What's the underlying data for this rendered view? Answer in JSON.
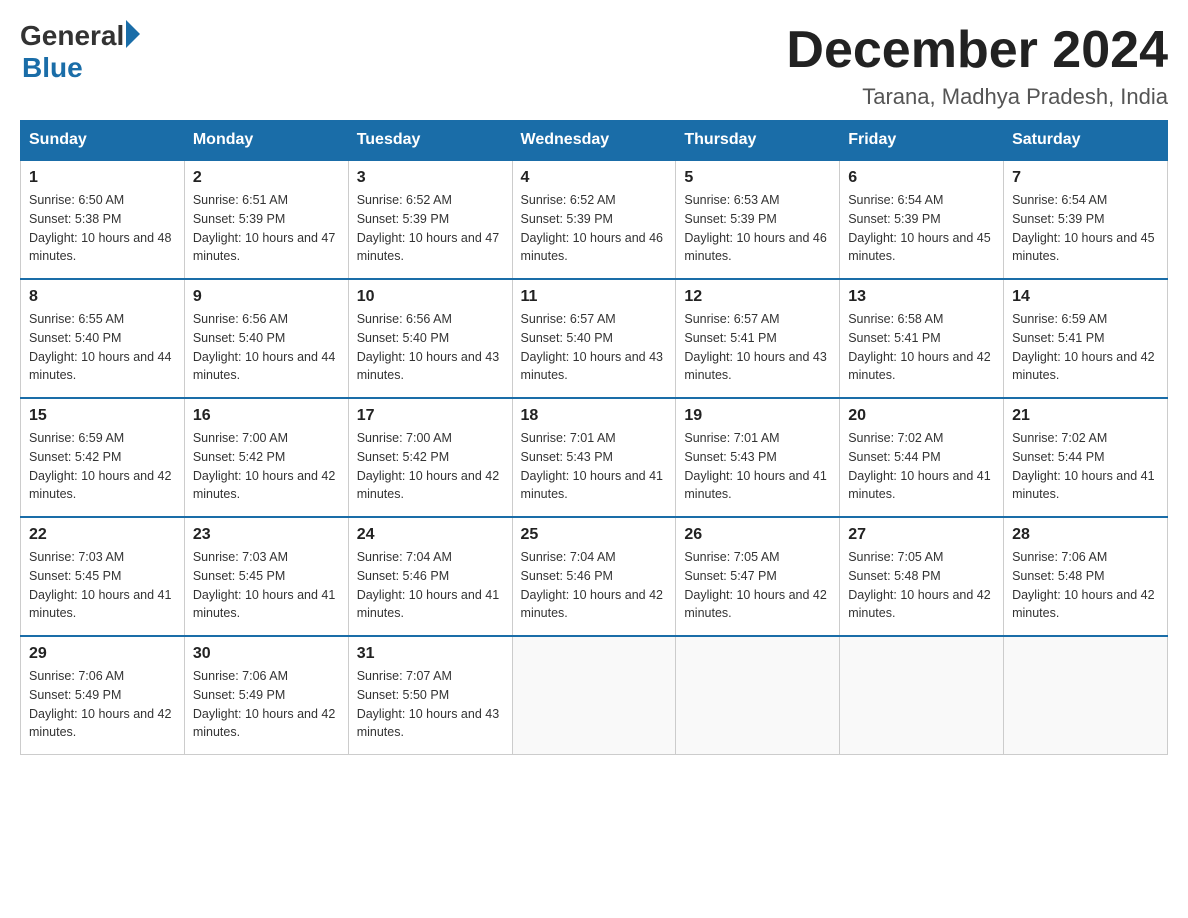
{
  "logo": {
    "general": "General",
    "blue": "Blue",
    "underline": "Blue"
  },
  "header": {
    "title": "December 2024",
    "subtitle": "Tarana, Madhya Pradesh, India"
  },
  "days_of_week": [
    "Sunday",
    "Monday",
    "Tuesday",
    "Wednesday",
    "Thursday",
    "Friday",
    "Saturday"
  ],
  "weeks": [
    [
      {
        "day": "1",
        "sunrise": "6:50 AM",
        "sunset": "5:38 PM",
        "daylight": "10 hours and 48 minutes."
      },
      {
        "day": "2",
        "sunrise": "6:51 AM",
        "sunset": "5:39 PM",
        "daylight": "10 hours and 47 minutes."
      },
      {
        "day": "3",
        "sunrise": "6:52 AM",
        "sunset": "5:39 PM",
        "daylight": "10 hours and 47 minutes."
      },
      {
        "day": "4",
        "sunrise": "6:52 AM",
        "sunset": "5:39 PM",
        "daylight": "10 hours and 46 minutes."
      },
      {
        "day": "5",
        "sunrise": "6:53 AM",
        "sunset": "5:39 PM",
        "daylight": "10 hours and 46 minutes."
      },
      {
        "day": "6",
        "sunrise": "6:54 AM",
        "sunset": "5:39 PM",
        "daylight": "10 hours and 45 minutes."
      },
      {
        "day": "7",
        "sunrise": "6:54 AM",
        "sunset": "5:39 PM",
        "daylight": "10 hours and 45 minutes."
      }
    ],
    [
      {
        "day": "8",
        "sunrise": "6:55 AM",
        "sunset": "5:40 PM",
        "daylight": "10 hours and 44 minutes."
      },
      {
        "day": "9",
        "sunrise": "6:56 AM",
        "sunset": "5:40 PM",
        "daylight": "10 hours and 44 minutes."
      },
      {
        "day": "10",
        "sunrise": "6:56 AM",
        "sunset": "5:40 PM",
        "daylight": "10 hours and 43 minutes."
      },
      {
        "day": "11",
        "sunrise": "6:57 AM",
        "sunset": "5:40 PM",
        "daylight": "10 hours and 43 minutes."
      },
      {
        "day": "12",
        "sunrise": "6:57 AM",
        "sunset": "5:41 PM",
        "daylight": "10 hours and 43 minutes."
      },
      {
        "day": "13",
        "sunrise": "6:58 AM",
        "sunset": "5:41 PM",
        "daylight": "10 hours and 42 minutes."
      },
      {
        "day": "14",
        "sunrise": "6:59 AM",
        "sunset": "5:41 PM",
        "daylight": "10 hours and 42 minutes."
      }
    ],
    [
      {
        "day": "15",
        "sunrise": "6:59 AM",
        "sunset": "5:42 PM",
        "daylight": "10 hours and 42 minutes."
      },
      {
        "day": "16",
        "sunrise": "7:00 AM",
        "sunset": "5:42 PM",
        "daylight": "10 hours and 42 minutes."
      },
      {
        "day": "17",
        "sunrise": "7:00 AM",
        "sunset": "5:42 PM",
        "daylight": "10 hours and 42 minutes."
      },
      {
        "day": "18",
        "sunrise": "7:01 AM",
        "sunset": "5:43 PM",
        "daylight": "10 hours and 41 minutes."
      },
      {
        "day": "19",
        "sunrise": "7:01 AM",
        "sunset": "5:43 PM",
        "daylight": "10 hours and 41 minutes."
      },
      {
        "day": "20",
        "sunrise": "7:02 AM",
        "sunset": "5:44 PM",
        "daylight": "10 hours and 41 minutes."
      },
      {
        "day": "21",
        "sunrise": "7:02 AM",
        "sunset": "5:44 PM",
        "daylight": "10 hours and 41 minutes."
      }
    ],
    [
      {
        "day": "22",
        "sunrise": "7:03 AM",
        "sunset": "5:45 PM",
        "daylight": "10 hours and 41 minutes."
      },
      {
        "day": "23",
        "sunrise": "7:03 AM",
        "sunset": "5:45 PM",
        "daylight": "10 hours and 41 minutes."
      },
      {
        "day": "24",
        "sunrise": "7:04 AM",
        "sunset": "5:46 PM",
        "daylight": "10 hours and 41 minutes."
      },
      {
        "day": "25",
        "sunrise": "7:04 AM",
        "sunset": "5:46 PM",
        "daylight": "10 hours and 42 minutes."
      },
      {
        "day": "26",
        "sunrise": "7:05 AM",
        "sunset": "5:47 PM",
        "daylight": "10 hours and 42 minutes."
      },
      {
        "day": "27",
        "sunrise": "7:05 AM",
        "sunset": "5:48 PM",
        "daylight": "10 hours and 42 minutes."
      },
      {
        "day": "28",
        "sunrise": "7:06 AM",
        "sunset": "5:48 PM",
        "daylight": "10 hours and 42 minutes."
      }
    ],
    [
      {
        "day": "29",
        "sunrise": "7:06 AM",
        "sunset": "5:49 PM",
        "daylight": "10 hours and 42 minutes."
      },
      {
        "day": "30",
        "sunrise": "7:06 AM",
        "sunset": "5:49 PM",
        "daylight": "10 hours and 42 minutes."
      },
      {
        "day": "31",
        "sunrise": "7:07 AM",
        "sunset": "5:50 PM",
        "daylight": "10 hours and 43 minutes."
      },
      null,
      null,
      null,
      null
    ]
  ]
}
